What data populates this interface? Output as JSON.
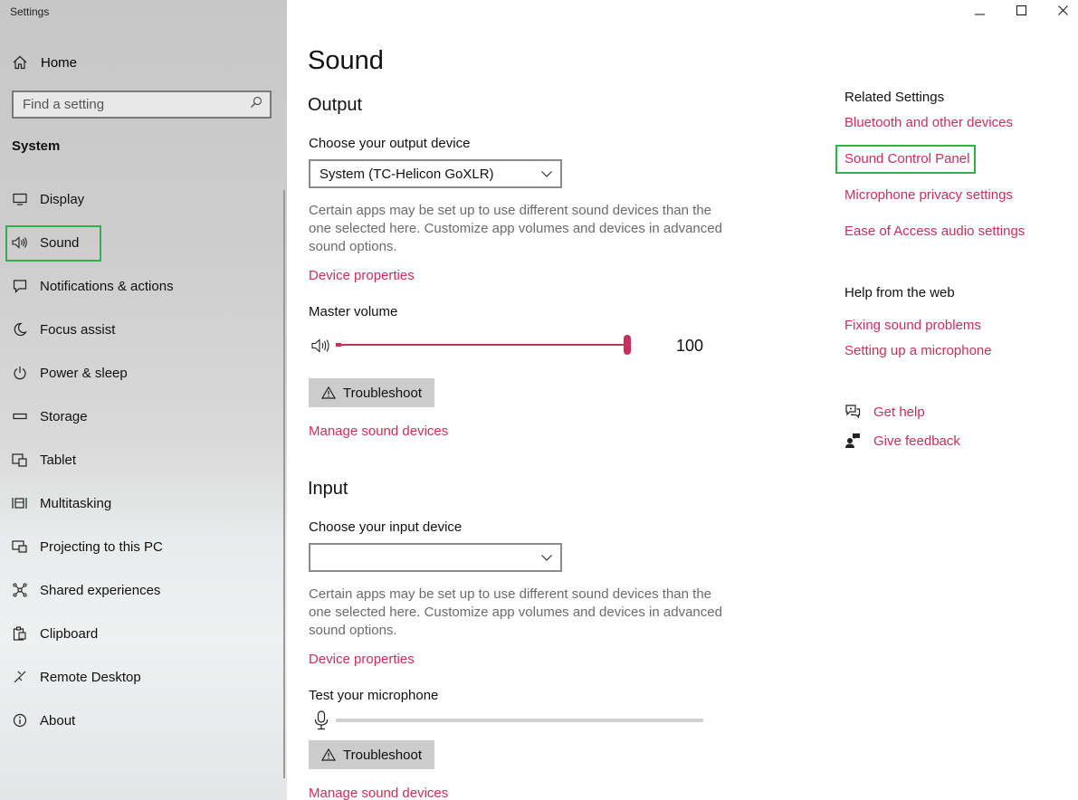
{
  "window": {
    "title": "Settings"
  },
  "sidebar": {
    "home_label": "Home",
    "search_placeholder": "Find a setting",
    "section_title": "System",
    "items": [
      {
        "label": "Display",
        "icon": "display-icon"
      },
      {
        "label": "Sound",
        "icon": "speaker-icon",
        "selected": true
      },
      {
        "label": "Notifications & actions",
        "icon": "notification-icon"
      },
      {
        "label": "Focus assist",
        "icon": "moon-icon"
      },
      {
        "label": "Power & sleep",
        "icon": "power-icon"
      },
      {
        "label": "Storage",
        "icon": "storage-icon"
      },
      {
        "label": "Tablet",
        "icon": "tablet-icon"
      },
      {
        "label": "Multitasking",
        "icon": "multitasking-icon"
      },
      {
        "label": "Projecting to this PC",
        "icon": "projecting-icon"
      },
      {
        "label": "Shared experiences",
        "icon": "shared-icon"
      },
      {
        "label": "Clipboard",
        "icon": "clipboard-icon"
      },
      {
        "label": "Remote Desktop",
        "icon": "remote-desktop-icon"
      },
      {
        "label": "About",
        "icon": "info-icon"
      }
    ]
  },
  "main": {
    "title": "Sound",
    "output": {
      "heading": "Output",
      "device_label": "Choose your output device",
      "device_value": "System (TC-Helicon GoXLR)",
      "note": "Certain apps may be set up to use different sound devices than the one selected here. Customize app volumes and devices in advanced sound options.",
      "device_properties": "Device properties",
      "master_volume_label": "Master volume",
      "master_volume_value": "100",
      "troubleshoot": "Troubleshoot",
      "manage_devices": "Manage sound devices"
    },
    "input": {
      "heading": "Input",
      "device_label": "Choose your input device",
      "device_value": "",
      "note": "Certain apps may be set up to use different sound devices than the one selected here. Customize app volumes and devices in advanced sound options.",
      "device_properties": "Device properties",
      "test_mic_label": "Test your microphone",
      "troubleshoot": "Troubleshoot",
      "manage_devices": "Manage sound devices"
    }
  },
  "related": {
    "title": "Related Settings",
    "links": [
      "Bluetooth and other devices",
      "Sound Control Panel",
      "Microphone privacy settings",
      "Ease of Access audio settings"
    ],
    "help_title": "Help from the web",
    "help_links": [
      "Fixing sound problems",
      "Setting up a microphone"
    ],
    "get_help": "Get help",
    "give_feedback": "Give feedback"
  },
  "colors": {
    "accent": "#c8305c",
    "highlight_box": "#2db34a"
  }
}
